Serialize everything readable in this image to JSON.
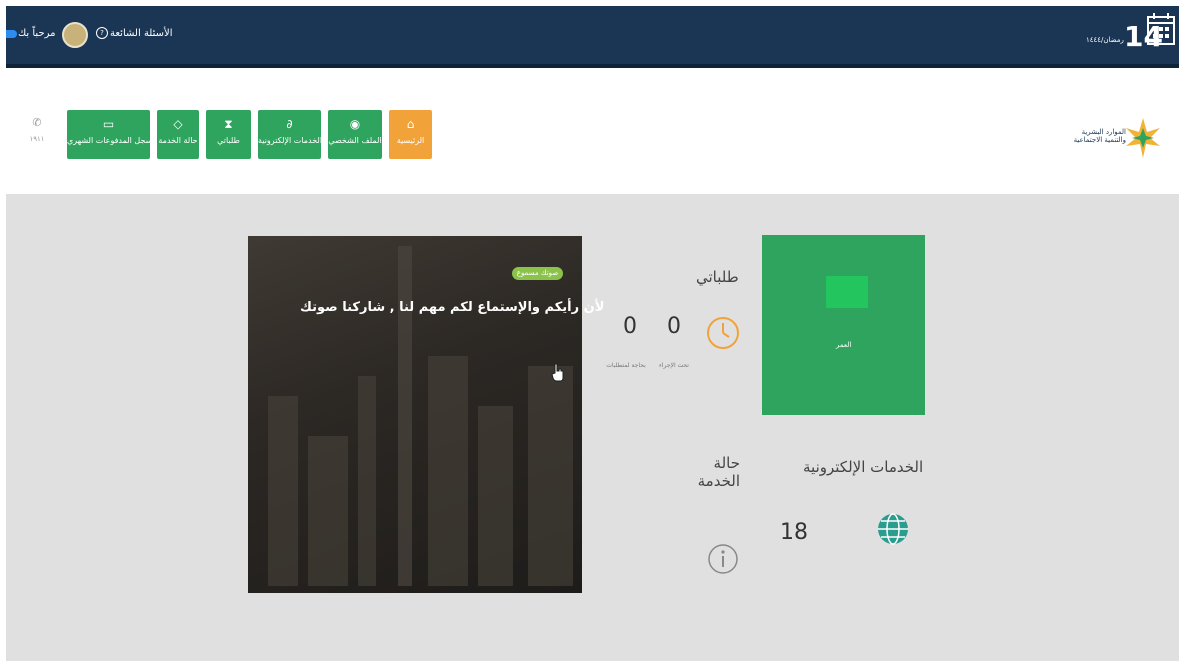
{
  "header": {
    "date_day": "14",
    "date_label": "رمضان/١٤٤٤",
    "help_label": "الأسئلة الشائعة",
    "user_name": "مرحباً بك"
  },
  "brand": {
    "line1": "الموارد البشرية",
    "line2": "والتنمية الاجتماعية"
  },
  "nav": {
    "items": [
      {
        "label": "الرئيسية",
        "icon": "home-icon"
      },
      {
        "label": "الملف الشخصي",
        "icon": "profile-icon"
      },
      {
        "label": "الخدمات الإلكترونية",
        "icon": "link-icon"
      },
      {
        "label": "طلباتي",
        "icon": "hourglass-icon"
      },
      {
        "label": "حالة الخدمة",
        "icon": "tag-icon"
      },
      {
        "label": "سجل المدفوعات الشهري",
        "icon": "calendar-icon"
      }
    ],
    "phone_number": "١٩١١",
    "active_color": "#f1a33a",
    "button_color": "#2fa45e"
  },
  "cards": {
    "green_card_label": "العمر",
    "requests_title": "طلباتي",
    "requests_current_value": "0",
    "requests_current_label": "تحت الإجراء",
    "requests_need_value": "0",
    "requests_need_label": "بحاجة لمتطلبات",
    "eservices_title": "الخدمات الإلكترونية",
    "eservices_count": "18",
    "status_title_line1": "حالة",
    "status_title_line2": "الخدمة"
  },
  "promo": {
    "badge": "صوتك مسموع",
    "text": "لأن رأيكم والإستماع لكم مهم لنا , شاركنا صوتك"
  }
}
